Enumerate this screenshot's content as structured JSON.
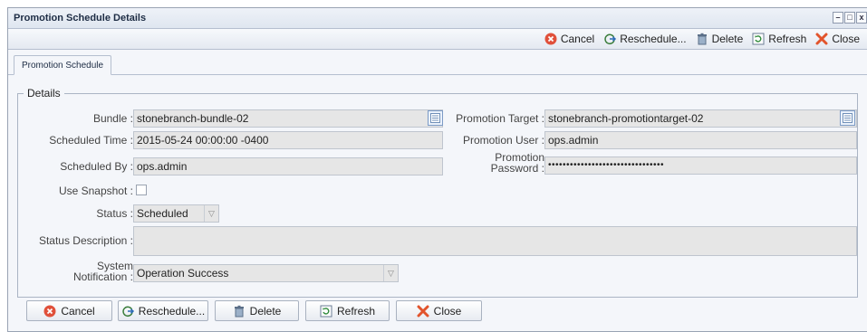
{
  "window": {
    "title": "Promotion Schedule Details"
  },
  "toolbar": {
    "cancel": "Cancel",
    "reschedule": "Reschedule...",
    "delete": "Delete",
    "refresh": "Refresh",
    "close": "Close"
  },
  "tabs": {
    "active": "Promotion Schedule"
  },
  "details": {
    "legend": "Details",
    "bundle_label": "Bundle :",
    "bundle_value": "stonebranch-bundle-02",
    "scheduled_time_label": "Scheduled Time :",
    "scheduled_time_value": "2015-05-24 00:00:00 -0400",
    "scheduled_by_label": "Scheduled By :",
    "scheduled_by_value": "ops.admin",
    "use_snapshot_label": "Use Snapshot :",
    "status_label": "Status :",
    "status_value": "Scheduled",
    "status_description_label": "Status Description :",
    "status_description_value": "",
    "system_notification_label_1": "System",
    "system_notification_label_2": "Notification :",
    "system_notification_value": "Operation Success",
    "promotion_target_label": "Promotion Target :",
    "promotion_target_value": "stonebranch-promotiontarget-02",
    "promotion_user_label": "Promotion User :",
    "promotion_user_value": "ops.admin",
    "promotion_password_label_1": "Promotion",
    "promotion_password_label_2": "Password :",
    "promotion_password_value": "••••••••••••••••••••••••••••••••"
  },
  "buttons": {
    "cancel": "Cancel",
    "reschedule": "Reschedule...",
    "delete": "Delete",
    "refresh": "Refresh",
    "close": "Close"
  }
}
